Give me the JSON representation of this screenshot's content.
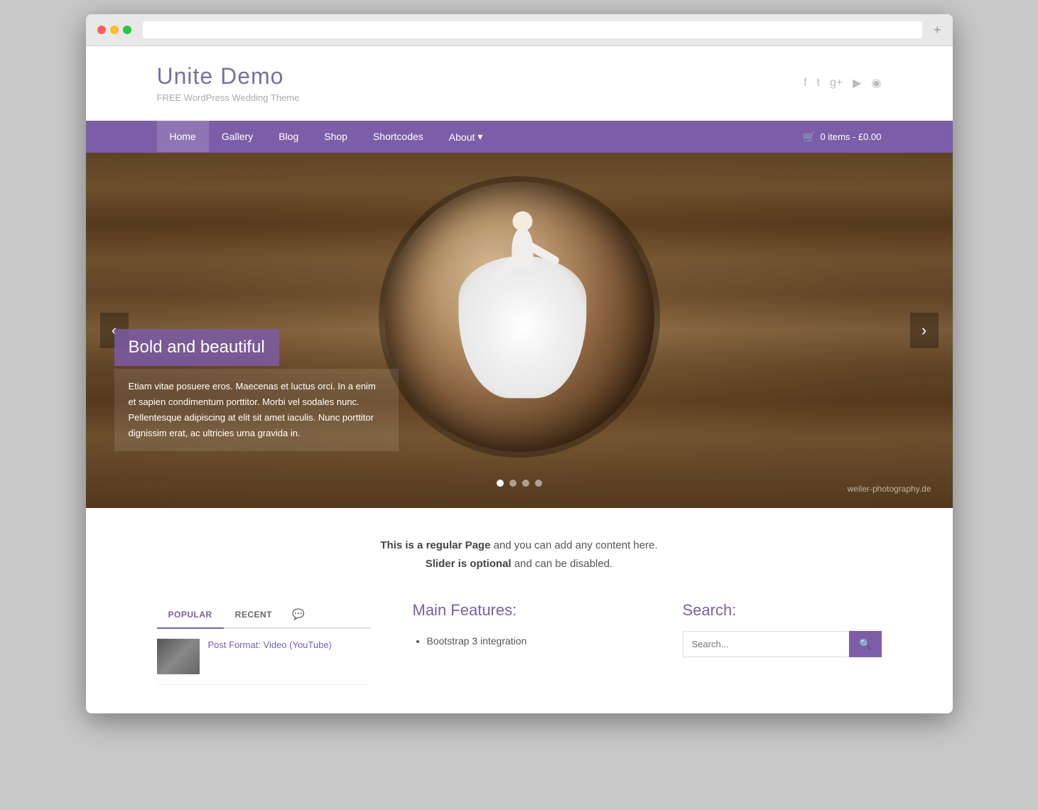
{
  "browser": {
    "add_tab_label": "+"
  },
  "header": {
    "site_title": "Unite Demo",
    "site_tagline": "FREE WordPress Wedding Theme",
    "social_icons": [
      "facebook",
      "twitter",
      "google-plus",
      "youtube",
      "rss"
    ]
  },
  "nav": {
    "items": [
      {
        "label": "Home",
        "active": true,
        "has_dropdown": false
      },
      {
        "label": "Gallery",
        "active": false,
        "has_dropdown": false
      },
      {
        "label": "Blog",
        "active": false,
        "has_dropdown": false
      },
      {
        "label": "Shop",
        "active": false,
        "has_dropdown": false
      },
      {
        "label": "Shortcodes",
        "active": false,
        "has_dropdown": false
      },
      {
        "label": "About",
        "active": false,
        "has_dropdown": true
      }
    ],
    "cart_label": "0 items - £0.00"
  },
  "slider": {
    "caption_title": "Bold and beautiful",
    "caption_text": "Etiam vitae posuere eros. Maecenas et luctus orci. In a enim et sapien condimentum porttitor. Morbi vel sodales nunc. Pellentesque adipiscing at elit sit amet iaculis. Nunc porttitor dignissim erat, ac ultricies urna gravida in.",
    "watermark": "weiler-photography.de",
    "prev_label": "‹",
    "next_label": "›",
    "dots": [
      {
        "active": true
      },
      {
        "active": false
      },
      {
        "active": false
      },
      {
        "active": false
      }
    ]
  },
  "page_intro": {
    "line1_bold": "This is a regular Page",
    "line1_rest": " and you can add any content here.",
    "line2_bold": "Slider is optional",
    "line2_rest": " and can be disabled."
  },
  "tabs_widget": {
    "tabs": [
      {
        "label": "POPULAR",
        "active": true
      },
      {
        "label": "RECENT",
        "active": false
      }
    ],
    "post": {
      "title": "Post Format: Video (YouTube)"
    }
  },
  "features_widget": {
    "title": "Main Features:",
    "items": [
      "Bootstrap 3 integration"
    ]
  },
  "search_widget": {
    "title": "Search:",
    "placeholder": "Search...",
    "button_label": "🔍"
  }
}
